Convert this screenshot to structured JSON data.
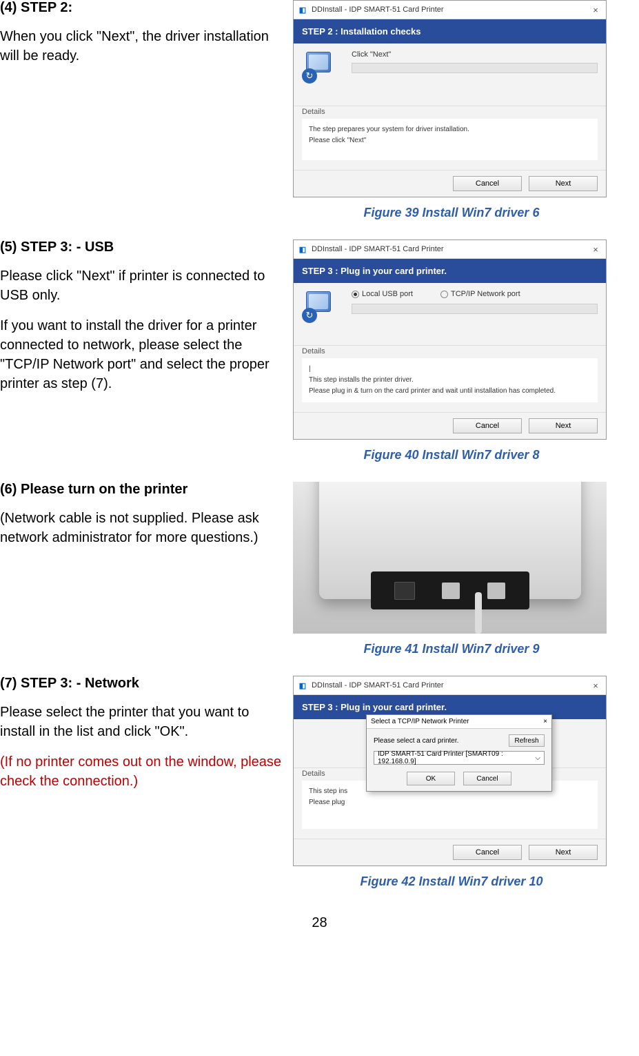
{
  "page_number": "28",
  "sections": [
    {
      "heading": "(4) STEP 2:",
      "paras": [
        "When you click \"Next\", the driver installation will be ready."
      ],
      "figure_caption": "Figure 39 Install Win7 driver 6",
      "dialog": {
        "title": "DDInstall  -  IDP SMART-51 Card Printer",
        "band": "STEP 2 :   Installation checks",
        "body_instr": "Click \"Next\"",
        "details_label": "Details",
        "details_lines": [
          "The step prepares your system for driver installation.",
          "Please click \"Next\""
        ],
        "cancel": "Cancel",
        "next": "Next"
      }
    },
    {
      "heading": "(5) STEP 3: - USB",
      "paras": [
        "Please click \"Next\" if printer is connected to USB only.",
        "If you want to install the driver for a printer connected to network, please select the \"TCP/IP Network port\" and select the proper printer as step (7)."
      ],
      "figure_caption": "Figure 40 Install Win7 driver 8",
      "dialog": {
        "title": "DDInstall  -  IDP SMART-51 Card Printer",
        "band": "STEP 3 :  Plug in your card printer.",
        "radio1": "Local USB port",
        "radio2": "TCP/IP Network port",
        "details_label": "Details",
        "details_lines": [
          "|",
          "This step installs the printer driver.",
          "Please plug in & turn on the card printer and wait until installation has completed."
        ],
        "cancel": "Cancel",
        "next": "Next"
      }
    },
    {
      "heading": "(6) Please turn on the printer",
      "paras": [
        "  (Network cable is not supplied. Please ask network administrator for more questions.)"
      ],
      "figure_caption": "Figure 41 Install Win7 driver 9"
    },
    {
      "heading": "(7) STEP 3: - Network",
      "paras": [
        "Please select the printer that you want to install in the list and click \"OK\"."
      ],
      "red_para": " (If no printer comes out on the window, please check the connection.)",
      "figure_caption": "Figure 42 Install Win7 driver 10",
      "dialog": {
        "title": "DDInstall  -  IDP SMART-51 Card Printer",
        "band": "STEP 3 :  Plug in your card printer.",
        "details_label": "Details",
        "details_lines": [
          "This step ins",
          "Please plug"
        ],
        "cancel": "Cancel",
        "next": "Next",
        "popup": {
          "title": "Select a TCP/IP Network Printer",
          "label": "Please select a card printer.",
          "refresh": "Refresh",
          "selected": "IDP SMART-51 Card Printer  [SMART09 : 192.168.0.9]",
          "ok": "OK",
          "cancel": "Cancel"
        }
      }
    }
  ]
}
